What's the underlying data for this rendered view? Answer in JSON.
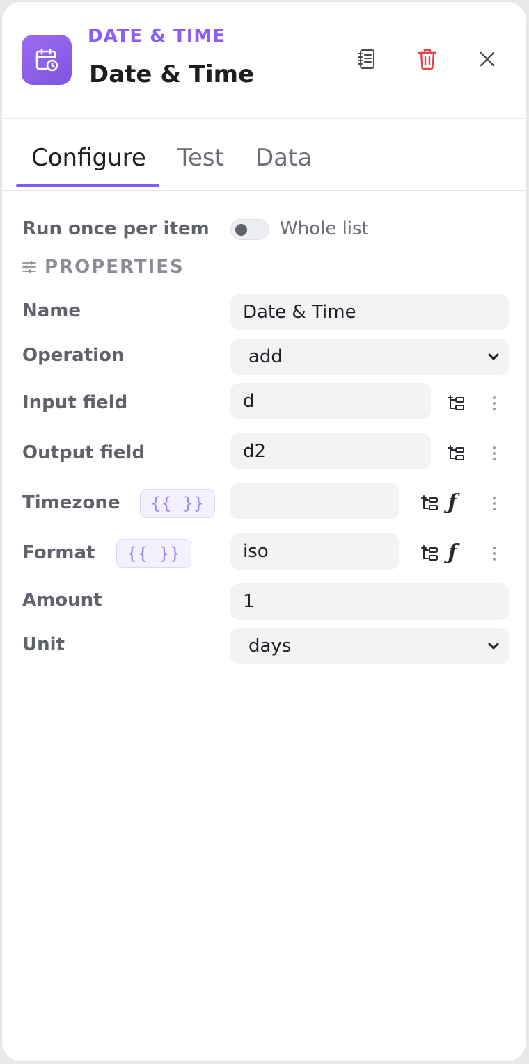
{
  "header": {
    "kicker": "DATE & TIME",
    "title": "Date & Time",
    "icons": [
      "calendar-clock-icon",
      "notes-icon",
      "trash-icon",
      "close-icon"
    ],
    "accent": "#8b5cf6",
    "danger": "#e0454c"
  },
  "tabs": [
    {
      "label": "Configure",
      "active": true
    },
    {
      "label": "Test",
      "active": false
    },
    {
      "label": "Data",
      "active": false
    }
  ],
  "run_mode": {
    "label": "Run once per item",
    "toggle_label": "Whole list",
    "toggle_on": false
  },
  "properties": {
    "section_title": "PROPERTIES",
    "name": {
      "label": "Name",
      "value": "Date & Time"
    },
    "operation": {
      "label": "Operation",
      "value": "add"
    },
    "input_field": {
      "label": "Input field",
      "value": "d"
    },
    "output_field": {
      "label": "Output field",
      "value": "d2"
    },
    "timezone": {
      "label": "Timezone",
      "chip": "{{ }}",
      "value": ""
    },
    "format": {
      "label": "Format",
      "chip": "{{ }}",
      "value": "iso"
    },
    "amount": {
      "label": "Amount",
      "value": "1"
    },
    "unit": {
      "label": "Unit",
      "value": "days"
    }
  }
}
